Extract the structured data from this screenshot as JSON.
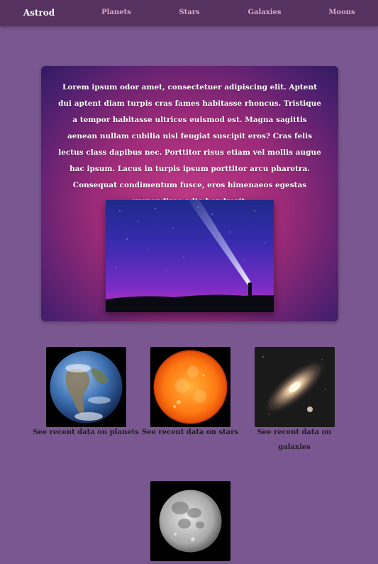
{
  "nav": {
    "brand": "Astrod",
    "items": [
      "Planets",
      "Stars",
      "Galaxies",
      "Moons"
    ]
  },
  "hero": {
    "text": "Lorem ipsum odor amet, consectetuer adipiscing elit. Aptent dui aptent diam turpis cras fames habitasse rhoncus. Tristique a tempor habitasse ultrices euismod est. Magna sagittis aenean nullam cubilia nisl feugiat suscipit eros? Cras felis lectus class dapibus nec. Porttitor risus etiam vel mollis augue hac ipsum. Lacus in turpis ipsum porttitor arcu pharetra. Consequat condimentum fusce, eros himenaeos egestas suspendisse odio hendrerit."
  },
  "cards": [
    {
      "caption": "See recent data on planets",
      "image": "earth"
    },
    {
      "caption": "See recent data on stars",
      "image": "sun"
    },
    {
      "caption": "See recent data on galaxies",
      "image": "galaxy"
    },
    {
      "caption": "",
      "image": "moon"
    }
  ],
  "colors": {
    "background": "#7a5790",
    "nav": "#55325f",
    "nav_link": "#dca9c8"
  }
}
